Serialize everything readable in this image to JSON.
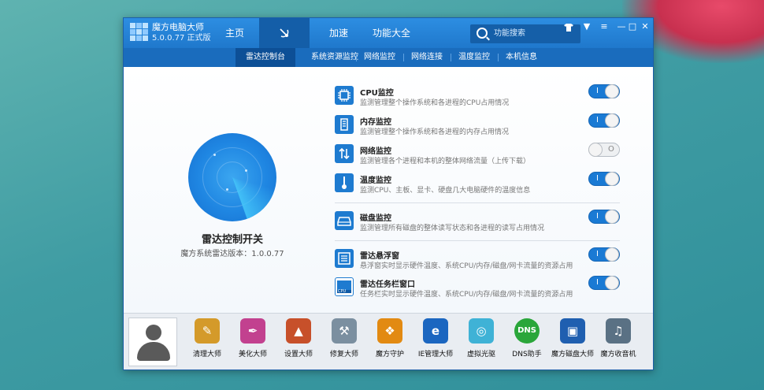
{
  "app": {
    "name": "魔方电脑大师",
    "version": "5.0.0.77 正式版"
  },
  "main_tabs": [
    {
      "label": "主页"
    },
    {
      "label": ""
    },
    {
      "label": "加速"
    },
    {
      "label": "功能大全"
    }
  ],
  "search": {
    "placeholder": "功能搜索"
  },
  "window_controls": {
    "skin": "▼",
    "menu": "≡",
    "min": "—",
    "max": "□",
    "close": "✕"
  },
  "sub_tabs": [
    {
      "label": "雷达控制台"
    },
    {
      "label": "系统资源监控"
    },
    {
      "label": "网络监控"
    },
    {
      "label": "网络连接"
    },
    {
      "label": "温度监控"
    },
    {
      "label": "本机信息"
    }
  ],
  "radar": {
    "title": "雷达控制开关",
    "version": "魔方系统雷达版本：1.0.0.77"
  },
  "features": [
    {
      "name": "CPU监控",
      "desc": "监测管理整个操作系统和各进程的CPU占用情况",
      "enabled": true,
      "toggle_label": "I"
    },
    {
      "name": "内存监控",
      "desc": "监测管理整个操作系统和各进程的内存占用情况",
      "enabled": true,
      "toggle_label": "I"
    },
    {
      "name": "网络监控",
      "desc": "监测管理各个进程和本机的整体网络流量（上传下载）",
      "enabled": false,
      "toggle_label": "O"
    },
    {
      "name": "温度监控",
      "desc": "监测CPU、主板、显卡、硬盘几大电脑硬件的温度信息",
      "enabled": true,
      "toggle_label": "I"
    },
    {
      "name": "磁盘监控",
      "desc": "监测管理所有磁盘的整体读写状态和各进程的读写占用情况",
      "enabled": true,
      "toggle_label": "I"
    },
    {
      "name": "雷达悬浮窗",
      "desc": "悬浮窗实时显示硬件温度、系统CPU/内存/磁盘/网卡流量的资源占用",
      "enabled": true,
      "toggle_label": "I"
    },
    {
      "name": "雷达任务栏窗口",
      "desc": "任务栏实时显示硬件温度、系统CPU/内存/磁盘/网卡流量的资源占用",
      "enabled": true,
      "toggle_label": "I"
    }
  ],
  "feature_icon_labels": {
    "cpu": "CPU"
  },
  "tools": [
    {
      "label": "清理大师",
      "icon": "broom-icon",
      "color": "#d49a2a"
    },
    {
      "label": "美化大师",
      "icon": "brush-icon",
      "color": "#c2418f"
    },
    {
      "label": "设置大师",
      "icon": "rocket-icon",
      "color": "#c7502a"
    },
    {
      "label": "修复大师",
      "icon": "wrench-icon",
      "color": "#7b8fa0"
    },
    {
      "label": "魔方守护",
      "icon": "shield-icon",
      "color": "#e28a12"
    },
    {
      "label": "IE管理大师",
      "icon": "ie-icon",
      "color": "#1b66c0"
    },
    {
      "label": "虚拟光驱",
      "icon": "disc-icon",
      "color": "#3fb2d6"
    },
    {
      "label": "DNS助手",
      "icon": "dns-icon",
      "color": "#2aa63a",
      "text": "DNS"
    },
    {
      "label": "魔方磁盘大师",
      "icon": "disk-icon",
      "color": "#1f5fb0"
    },
    {
      "label": "魔方收音机",
      "icon": "radio-icon",
      "color": "#5a7184"
    }
  ]
}
